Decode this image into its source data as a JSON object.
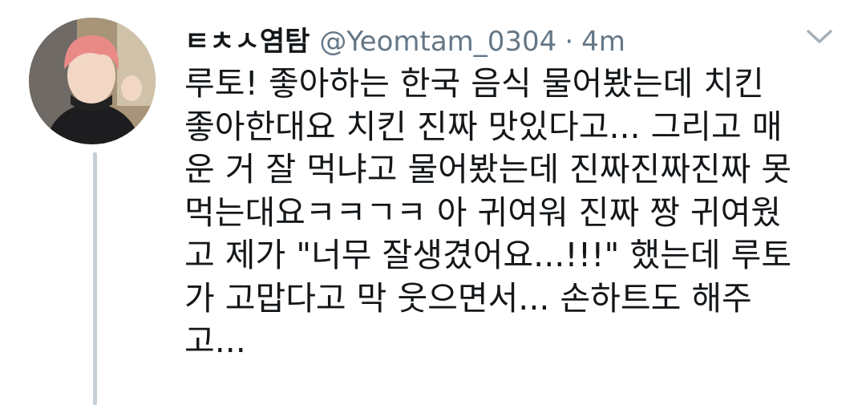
{
  "tweet": {
    "author_name": "ㅌㅊㅅ염탐",
    "handle": "@Yeomtam_0304",
    "separator": "·",
    "time": "4m",
    "text_lines": [
      "루토! 좋아하는 한국 음식 물어봤는데 치킨",
      "좋아한대요 치킨 진짜 맛있다고... 그리고 매",
      "운 거 잘 먹냐고 물어봤는데 진짜진짜진짜 못",
      "먹는대요ㅋㅋㄱㅋ 아 귀여워 진짜 짱 귀여웠",
      "고 제가 \"너무 잘생겼어요...!!!\" 했는데 루토",
      "가 고맙다고 막 웃으면서... 손하트도 해주",
      "고..."
    ]
  },
  "icons": {
    "avatar": "profile-photo",
    "menu": "chevron-down-icon"
  },
  "colors": {
    "text": "#14171a",
    "secondary_text": "#657786",
    "thread_line": "#c4cfd6",
    "background": "#ffffff"
  }
}
